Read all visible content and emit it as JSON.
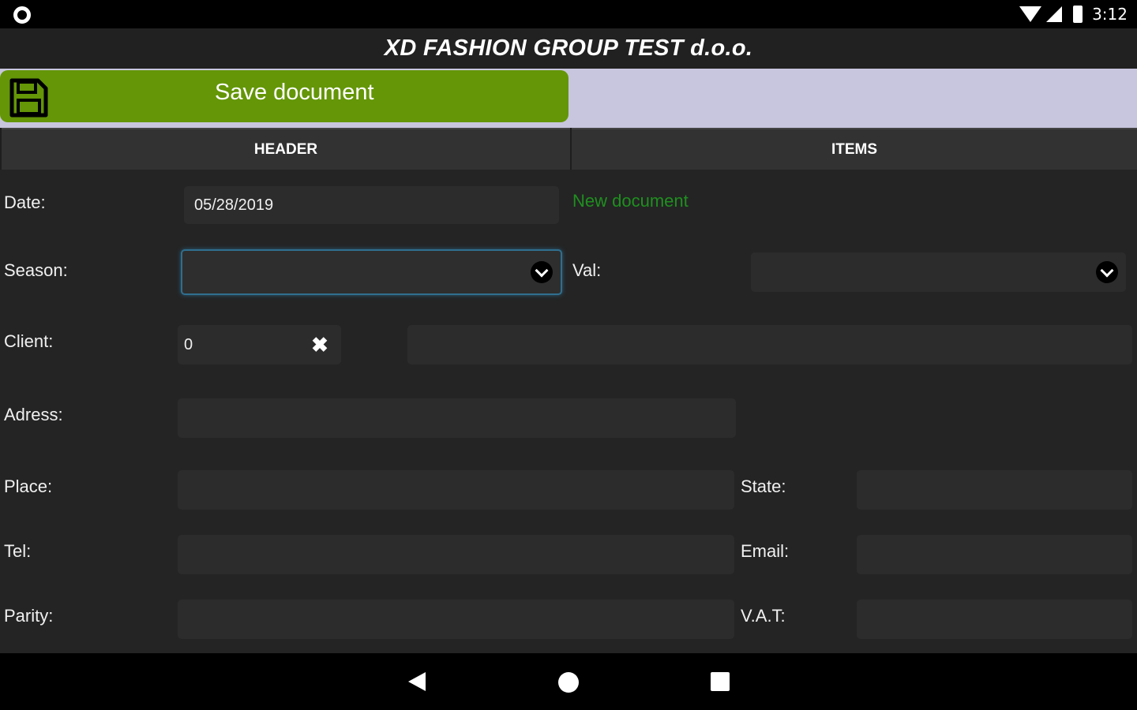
{
  "status_bar": {
    "time": "3:12",
    "icons": [
      "circle-icon",
      "wifi-icon",
      "signal-icon",
      "battery-icon"
    ]
  },
  "app": {
    "title": "XD FASHION GROUP TEST d.o.o."
  },
  "toolbar": {
    "save_label": "Save document",
    "save_icon": "floppy-disk-icon",
    "accent_color": "#649607"
  },
  "tabs": [
    {
      "label": "HEADER",
      "active": true
    },
    {
      "label": "ITEMS",
      "active": false
    }
  ],
  "form": {
    "date_label": "Date:",
    "date_value": "05/28/2019",
    "status_note": "New document",
    "season_label": "Season:",
    "season_value": "",
    "val_label": "Val:",
    "val_value": "",
    "client_label": "Client:",
    "client_code": "0",
    "client_name": "",
    "address_label": "Adress:",
    "address_value": "",
    "place_label": "Place:",
    "place_value": "",
    "state_label": "State:",
    "state_value": "",
    "tel_label": "Tel:",
    "tel_value": "",
    "email_label": "Email:",
    "email_value": "",
    "parity_label": "Parity:",
    "parity_value": "",
    "vat_label": "V.A.T:",
    "vat_value": ""
  },
  "nav_bar": {
    "icons": [
      "back-icon",
      "home-icon",
      "recent-apps-icon"
    ]
  }
}
